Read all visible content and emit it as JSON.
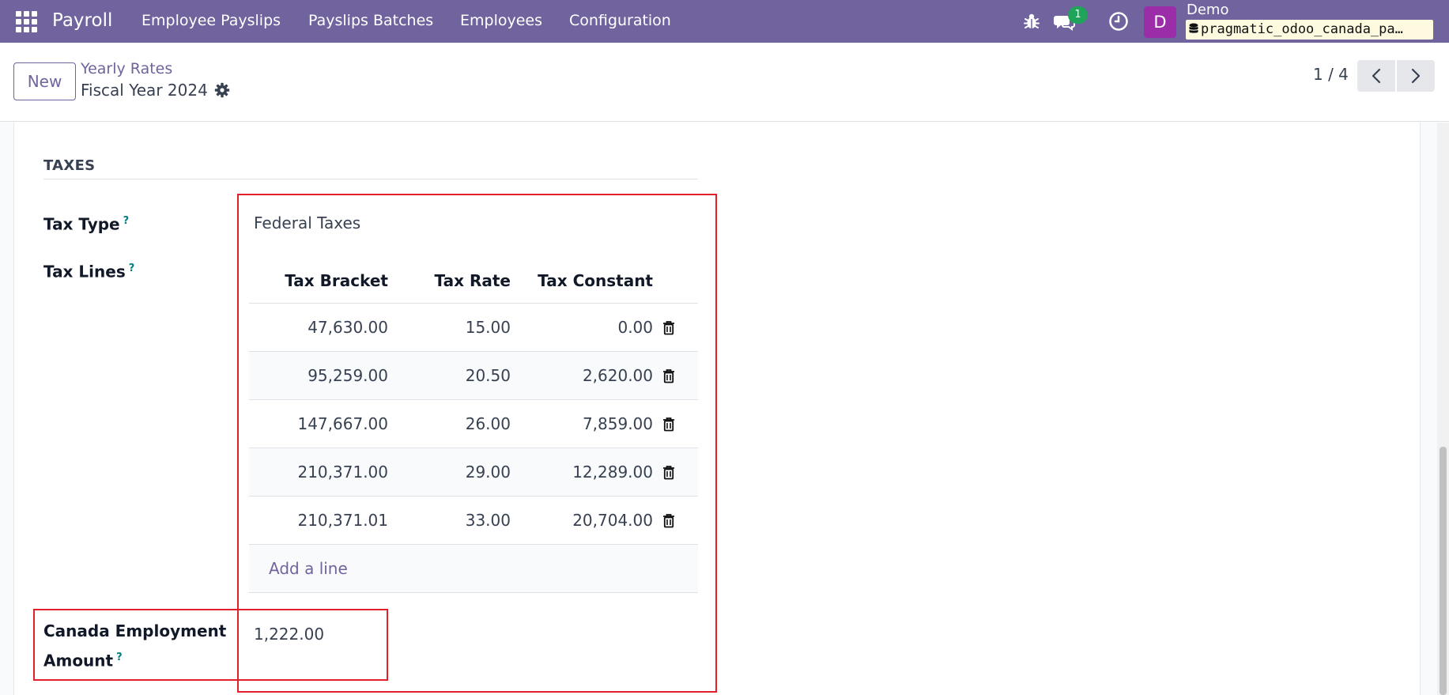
{
  "navbar": {
    "app_name": "Payroll",
    "menu": [
      "Employee Payslips",
      "Payslips Batches",
      "Employees",
      "Configuration"
    ],
    "messages_count": "1",
    "avatar_letter": "D",
    "user_name": "Demo",
    "database": "pragmatic_odoo_canada_pa…",
    "icons": [
      "apps-grid-icon",
      "bug-icon",
      "chat-icon",
      "clock-icon",
      "database-icon"
    ]
  },
  "control": {
    "new_label": "New",
    "breadcrumb_parent": "Yearly Rates",
    "breadcrumb_current": "Fiscal Year 2024",
    "pager": "1 / 4"
  },
  "form": {
    "section_title": "TAXES",
    "tax_type_label": "Tax Type",
    "tax_type_value": "Federal Taxes",
    "tax_lines_label": "Tax Lines",
    "help_mark": "?",
    "table": {
      "headers": [
        "Tax Bracket",
        "Tax Rate",
        "Tax Constant"
      ],
      "rows": [
        [
          "47,630.00",
          "15.00",
          "0.00"
        ],
        [
          "95,259.00",
          "20.50",
          "2,620.00"
        ],
        [
          "147,667.00",
          "26.00",
          "7,859.00"
        ],
        [
          "210,371.00",
          "29.00",
          "12,289.00"
        ],
        [
          "210,371.01",
          "33.00",
          "20,704.00"
        ]
      ],
      "add_line": "Add a line"
    },
    "cea_label_line1": "Canada Employment",
    "cea_label_line2": "Amount",
    "cea_value": "1,222.00"
  },
  "colors": {
    "navbar": "#71639e",
    "accent": "#71639e",
    "badge": "#1fa45a",
    "avatar": "#9b2ea8",
    "highlight": "#e0202a"
  }
}
